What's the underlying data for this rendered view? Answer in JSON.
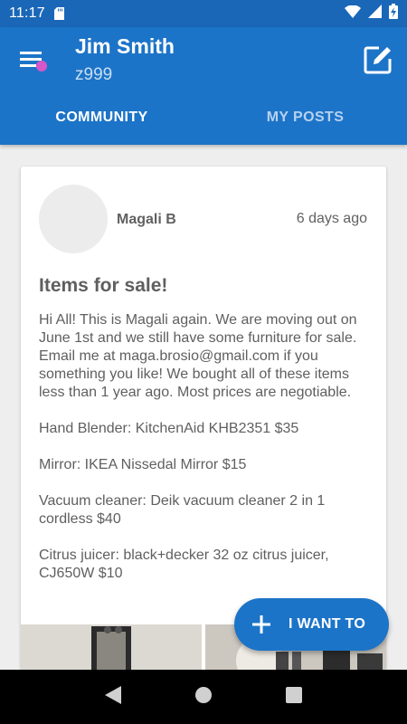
{
  "status_bar": {
    "time": "11:17",
    "icons": [
      "sd-card-icon",
      "wifi-icon",
      "signal-icon",
      "battery-charging-icon"
    ]
  },
  "header": {
    "user_name": "Jim Smith",
    "user_id": "z999",
    "menu_icon": "menu-icon",
    "edit_icon": "edit-icon"
  },
  "tabs": [
    {
      "label": "COMMUNITY",
      "active": true
    },
    {
      "label": "MY POSTS",
      "active": false
    }
  ],
  "post": {
    "author": "Magali B",
    "time": "6 days ago",
    "title": "Items for sale!",
    "paragraphs": [
      "Hi All! This is Magali again. We are moving out on June 1st and we still have some furniture for sale. Email me at maga.brosio@gmail.com if you something you like! We bought all of these items less than 1 year ago. Most prices are negotiable.",
      "Hand Blender: KitchenAid KHB2351 $35",
      "Mirror: IKEA Nissedal Mirror $15",
      "Vacuum cleaner: Deik vacuum cleaner 2 in 1 cordless $40",
      "Citrus juicer: black+decker 32 oz citrus juicer, CJ650W $10"
    ]
  },
  "fab": {
    "label": "I WANT TO",
    "icon": "plus-icon"
  },
  "nav": {
    "icons": [
      "back-icon",
      "home-icon",
      "recents-icon"
    ]
  },
  "colors": {
    "primary": "#1c74c8",
    "status_bar": "#1a67b8",
    "accent_dot": "#d756c9",
    "background": "#eeeeee",
    "text": "#5f5f5f"
  }
}
